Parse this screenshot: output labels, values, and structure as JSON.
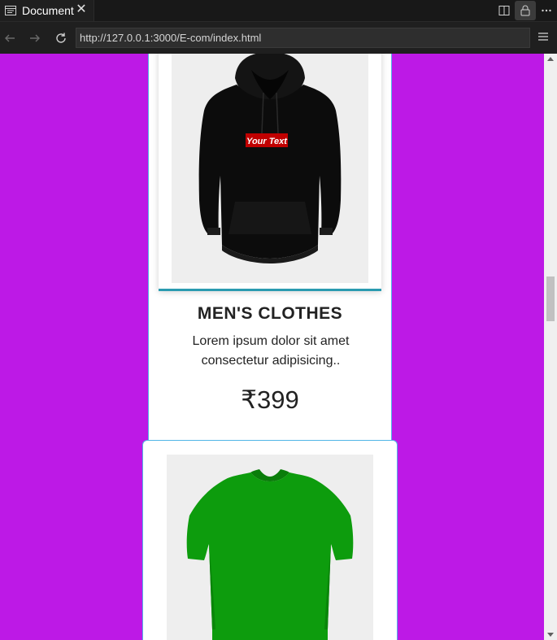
{
  "tab": {
    "title": "Document",
    "close_symbol": "✕"
  },
  "nav": {
    "url": "http://127.0.0.1:3000/E-com/index.html"
  },
  "product1": {
    "title": "MEN'S CLOTHES",
    "description": "Lorem ipsum dolor sit amet consectetur adipisicing..",
    "price": "₹399",
    "print_text": "Your Text"
  },
  "colors": {
    "page_bg": "#bd19e6",
    "accent": "#2a9bb0",
    "card_border": "#52b6e6",
    "tshirt": "#0d9c0d"
  },
  "icons": [
    "document-tab-icon",
    "close-icon",
    "split-view-icon",
    "lock-icon",
    "more-icon",
    "back-icon",
    "forward-icon",
    "reload-icon",
    "menu-icon"
  ]
}
